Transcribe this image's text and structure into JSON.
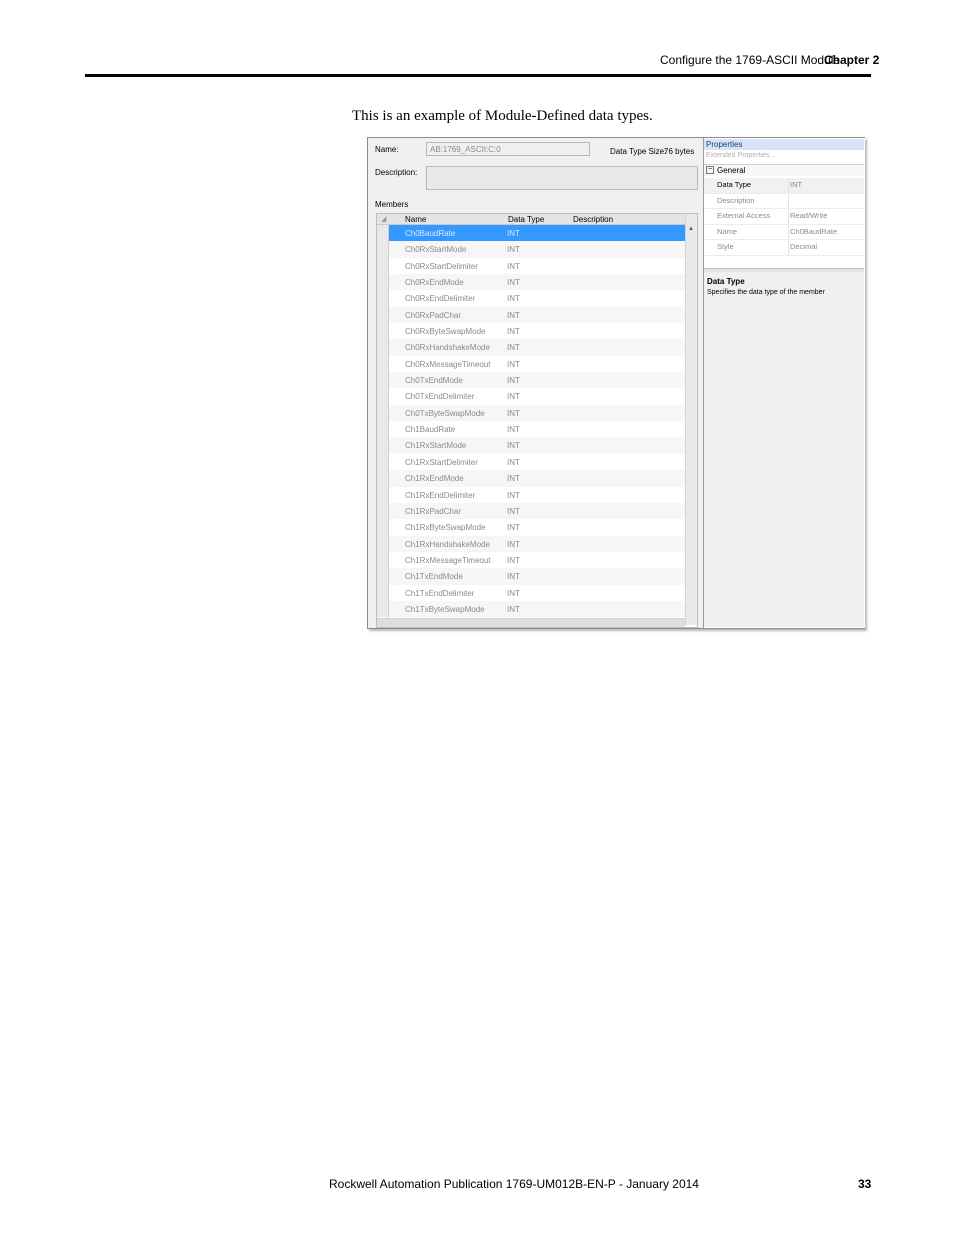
{
  "header": {
    "section_title": "Configure the 1769-ASCII Module",
    "chapter": "Chapter 2"
  },
  "intro_text": "This is an example of Module-Defined data types.",
  "editor": {
    "name_label": "Name:",
    "name_value": "AB:1769_ASCII:C:0",
    "size_label": "Data Type Size:",
    "size_value": "76 bytes",
    "description_label": "Description:",
    "members_label": "Members",
    "columns": {
      "name": "Name",
      "type": "Data Type",
      "description": "Description"
    },
    "members": [
      {
        "name": "Ch0BaudRate",
        "type": "INT"
      },
      {
        "name": "Ch0RxStartMode",
        "type": "INT"
      },
      {
        "name": "Ch0RxStartDelimiter",
        "type": "INT"
      },
      {
        "name": "Ch0RxEndMode",
        "type": "INT"
      },
      {
        "name": "Ch0RxEndDelimiter",
        "type": "INT"
      },
      {
        "name": "Ch0RxPadChar",
        "type": "INT"
      },
      {
        "name": "Ch0RxByteSwapMode",
        "type": "INT"
      },
      {
        "name": "Ch0RxHandshakeMode",
        "type": "INT"
      },
      {
        "name": "Ch0RxMessageTimeout",
        "type": "INT"
      },
      {
        "name": "Ch0TxEndMode",
        "type": "INT"
      },
      {
        "name": "Ch0TxEndDelimiter",
        "type": "INT"
      },
      {
        "name": "Ch0TxByteSwapMode",
        "type": "INT"
      },
      {
        "name": "Ch1BaudRate",
        "type": "INT"
      },
      {
        "name": "Ch1RxStartMode",
        "type": "INT"
      },
      {
        "name": "Ch1RxStartDelimiter",
        "type": "INT"
      },
      {
        "name": "Ch1RxEndMode",
        "type": "INT"
      },
      {
        "name": "Ch1RxEndDelimiter",
        "type": "INT"
      },
      {
        "name": "Ch1RxPadChar",
        "type": "INT"
      },
      {
        "name": "Ch1RxByteSwapMode",
        "type": "INT"
      },
      {
        "name": "Ch1RxHandshakeMode",
        "type": "INT"
      },
      {
        "name": "Ch1RxMessageTimeout",
        "type": "INT"
      },
      {
        "name": "Ch1TxEndMode",
        "type": "INT"
      },
      {
        "name": "Ch1TxEndDelimiter",
        "type": "INT"
      },
      {
        "name": "Ch1TxByteSwapMode",
        "type": "INT"
      }
    ],
    "selected_index": 0
  },
  "properties": {
    "title": "Properties",
    "extended": "Extended Properties...",
    "group": "General",
    "rows": [
      {
        "key": "Data Type",
        "value": "INT"
      },
      {
        "key": "Description",
        "value": ""
      },
      {
        "key": "External Access",
        "value": "Read/Write"
      },
      {
        "key": "Name",
        "value": "Ch0BaudRate"
      },
      {
        "key": "Style",
        "value": "Decimal"
      }
    ],
    "help_title": "Data Type",
    "help_text": "Specifies the data type of the member"
  },
  "footer": {
    "publication": "Rockwell Automation Publication 1769-UM012B-EN-P - January 2014",
    "page_number": "33"
  }
}
